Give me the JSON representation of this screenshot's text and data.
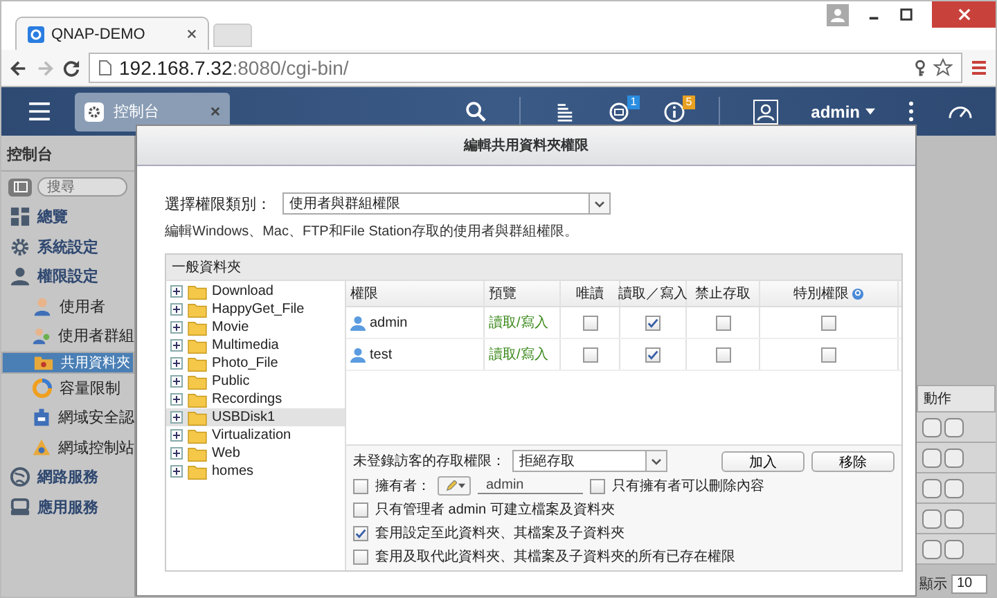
{
  "browser": {
    "tab_title": "QNAP-DEMO",
    "url_host": "192.168.7.32",
    "url_path": ":8080/cgi-bin/"
  },
  "header": {
    "app_tab": "控制台",
    "notification_count": "1",
    "info_count": "5",
    "user": "admin"
  },
  "sidebar": {
    "title": "控制台",
    "search": {
      "placeholder": "搜尋"
    },
    "items": [
      {
        "label": "總覽",
        "selected": false
      },
      {
        "label": "系統設定",
        "selected": false
      },
      {
        "label": "權限設定",
        "selected": false,
        "children": [
          {
            "label": "使用者",
            "selected": false
          },
          {
            "label": "使用者群組",
            "selected": false
          },
          {
            "label": "共用資料夾",
            "selected": true
          },
          {
            "label": "容量限制",
            "selected": false
          },
          {
            "label": "網域安全認",
            "selected": false
          },
          {
            "label": "網域控制站",
            "selected": false
          }
        ]
      },
      {
        "label": "網路服務",
        "selected": false
      },
      {
        "label": "應用服務",
        "selected": false
      }
    ]
  },
  "dialog": {
    "title": "編輯共用資料夾權限",
    "permission_type": {
      "label": "選擇權限類別：",
      "value": "使用者與群組權限"
    },
    "description": "編輯Windows、Mac、FTP和File Station存取的使用者與群組權限。",
    "panel_title": "一般資料夾",
    "folders": [
      {
        "name": "Download",
        "selected": false
      },
      {
        "name": "HappyGet_File",
        "selected": false
      },
      {
        "name": "Movie",
        "selected": false
      },
      {
        "name": "Multimedia",
        "selected": false
      },
      {
        "name": "Photo_File",
        "selected": false
      },
      {
        "name": "Public",
        "selected": false
      },
      {
        "name": "Recordings",
        "selected": false
      },
      {
        "name": "USBDisk1",
        "selected": true
      },
      {
        "name": "Virtualization",
        "selected": false
      },
      {
        "name": "Web",
        "selected": false
      },
      {
        "name": "homes",
        "selected": false
      }
    ],
    "table": {
      "columns": [
        "權限",
        "預覽",
        "唯讀",
        "讀取／寫入",
        "禁止存取",
        "特別權限"
      ],
      "rows": [
        {
          "name": "admin",
          "preview": "讀取/寫入",
          "read_only": false,
          "read_write": true,
          "deny": false,
          "special": false
        },
        {
          "name": "test",
          "preview": "讀取/寫入",
          "read_only": false,
          "read_write": true,
          "deny": false,
          "special": false
        }
      ]
    },
    "guest_access": {
      "label": "未登錄訪客的存取權限：",
      "value": "拒絕存取"
    },
    "buttons": [
      "加入",
      "移除"
    ],
    "owner": {
      "checked": false,
      "label": "擁有者：",
      "value": "admin"
    },
    "owner_only_delete": {
      "checked": false,
      "label": "只有擁有者可以刪除內容"
    },
    "options": [
      {
        "label": "只有管理者 admin 可建立檔案及資料夾",
        "checked": false
      },
      {
        "label": "套用設定至此資料夾、其檔案及子資料夾",
        "checked": true
      },
      {
        "label": "套用及取代此資料夾、其檔案及子資料夾的所有已存在權限",
        "checked": false
      }
    ]
  },
  "background_panel": {
    "action_header": "動作",
    "page_size_label": "顯示",
    "page_size": "10"
  }
}
